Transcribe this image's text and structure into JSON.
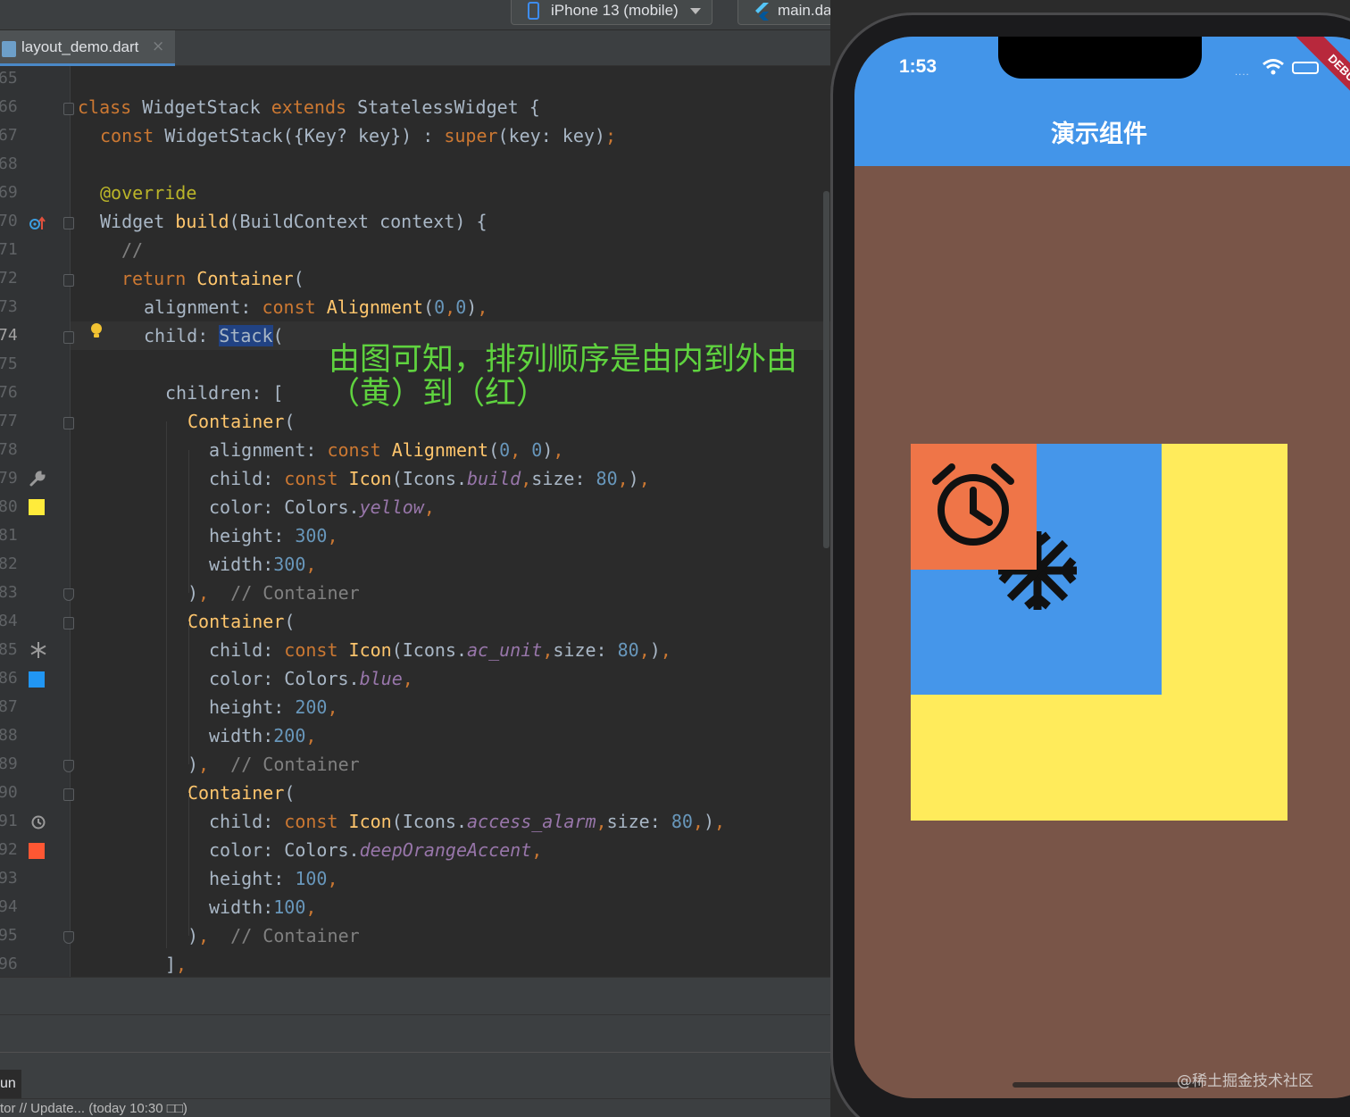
{
  "toolbar": {
    "device_selector": "iPhone 13 (mobile)",
    "config_selector": "main.dart"
  },
  "tab": {
    "filename": "layout_demo.dart",
    "close_glyph": "×"
  },
  "editor": {
    "lines": [
      {
        "n": "65"
      },
      {
        "n": "66"
      },
      {
        "n": "67"
      },
      {
        "n": "68"
      },
      {
        "n": "69"
      },
      {
        "n": "70"
      },
      {
        "n": "71"
      },
      {
        "n": "72"
      },
      {
        "n": "73"
      },
      {
        "n": "74"
      },
      {
        "n": "75"
      },
      {
        "n": "76"
      },
      {
        "n": "77"
      },
      {
        "n": "78"
      },
      {
        "n": "79"
      },
      {
        "n": "80"
      },
      {
        "n": "81"
      },
      {
        "n": "82"
      },
      {
        "n": "83"
      },
      {
        "n": "84"
      },
      {
        "n": "85"
      },
      {
        "n": "86"
      },
      {
        "n": "87"
      },
      {
        "n": "88"
      },
      {
        "n": "89"
      },
      {
        "n": "90"
      },
      {
        "n": "91"
      },
      {
        "n": "92"
      },
      {
        "n": "93"
      },
      {
        "n": "94"
      },
      {
        "n": "95"
      },
      {
        "n": "96"
      }
    ],
    "code": {
      "l66": [
        [
          "kw",
          "class "
        ],
        [
          "pl",
          "WidgetStack "
        ],
        [
          "kw",
          "extends "
        ],
        [
          "pl",
          "StatelessWidget {"
        ]
      ],
      "l67": [
        [
          "kw",
          "const "
        ],
        [
          "pl",
          "WidgetStack({Key? key}) : "
        ],
        [
          "kw",
          "super"
        ],
        [
          "pl",
          "(key: key)"
        ],
        [
          "kw",
          ";"
        ]
      ],
      "l69": [
        [
          "an",
          "@override"
        ]
      ],
      "l70": [
        [
          "pl",
          "Widget "
        ],
        [
          "fn",
          "build"
        ],
        [
          "pl",
          "(BuildContext context) {"
        ]
      ],
      "l71": [
        [
          "cm",
          "//"
        ]
      ],
      "l72": [
        [
          "kw",
          "return "
        ],
        [
          "fn",
          "Container"
        ],
        [
          "pl",
          "("
        ]
      ],
      "l73": [
        [
          "pl",
          "alignment: "
        ],
        [
          "kw",
          "const "
        ],
        [
          "fn",
          "Alignment"
        ],
        [
          "pl",
          "("
        ],
        [
          "nm",
          "0"
        ],
        [
          "kw",
          ","
        ],
        [
          "nm",
          "0"
        ],
        [
          "pl",
          ")"
        ],
        [
          "kw",
          ","
        ]
      ],
      "l74": [
        [
          "pl",
          "child: "
        ],
        [
          "hl",
          "Stack"
        ],
        [
          "pl",
          "("
        ]
      ],
      "l76": [
        [
          "pl",
          "children: ["
        ]
      ],
      "l77": [
        [
          "fn",
          "Container"
        ],
        [
          "pl",
          "("
        ]
      ],
      "l78": [
        [
          "pl",
          "alignment: "
        ],
        [
          "kw",
          "const "
        ],
        [
          "fn",
          "Alignment"
        ],
        [
          "pl",
          "("
        ],
        [
          "nm",
          "0"
        ],
        [
          "kw",
          ", "
        ],
        [
          "nm",
          "0"
        ],
        [
          "pl",
          ")"
        ],
        [
          "kw",
          ","
        ]
      ],
      "l79": [
        [
          "pl",
          "child: "
        ],
        [
          "kw",
          "const "
        ],
        [
          "fn",
          "Icon"
        ],
        [
          "pl",
          "(Icons."
        ],
        [
          "it",
          "build"
        ],
        [
          "kw",
          ","
        ],
        [
          "pl",
          "size: "
        ],
        [
          "nm",
          "80"
        ],
        [
          "kw",
          ","
        ],
        [
          "pl",
          ")"
        ],
        [
          "kw",
          ","
        ]
      ],
      "l80": [
        [
          "pl",
          "color: Colors."
        ],
        [
          "it",
          "yellow"
        ],
        [
          "kw",
          ","
        ]
      ],
      "l81": [
        [
          "pl",
          "height: "
        ],
        [
          "nm",
          "300"
        ],
        [
          "kw",
          ","
        ]
      ],
      "l82": [
        [
          "pl",
          "width:"
        ],
        [
          "nm",
          "300"
        ],
        [
          "kw",
          ","
        ]
      ],
      "l83": [
        [
          "pl",
          ")"
        ],
        [
          "kw",
          ","
        ],
        [
          "cm",
          "  // Container"
        ]
      ],
      "l84": [
        [
          "fn",
          "Container"
        ],
        [
          "pl",
          "("
        ]
      ],
      "l85": [
        [
          "pl",
          "child: "
        ],
        [
          "kw",
          "const "
        ],
        [
          "fn",
          "Icon"
        ],
        [
          "pl",
          "(Icons."
        ],
        [
          "it",
          "ac_unit"
        ],
        [
          "kw",
          ","
        ],
        [
          "pl",
          "size: "
        ],
        [
          "nm",
          "80"
        ],
        [
          "kw",
          ","
        ],
        [
          "pl",
          ")"
        ],
        [
          "kw",
          ","
        ]
      ],
      "l86": [
        [
          "pl",
          "color: Colors."
        ],
        [
          "it",
          "blue"
        ],
        [
          "kw",
          ","
        ]
      ],
      "l87": [
        [
          "pl",
          "height: "
        ],
        [
          "nm",
          "200"
        ],
        [
          "kw",
          ","
        ]
      ],
      "l88": [
        [
          "pl",
          "width:"
        ],
        [
          "nm",
          "200"
        ],
        [
          "kw",
          ","
        ]
      ],
      "l89": [
        [
          "pl",
          ")"
        ],
        [
          "kw",
          ","
        ],
        [
          "cm",
          "  // Container"
        ]
      ],
      "l90": [
        [
          "fn",
          "Container"
        ],
        [
          "pl",
          "("
        ]
      ],
      "l91": [
        [
          "pl",
          "child: "
        ],
        [
          "kw",
          "const "
        ],
        [
          "fn",
          "Icon"
        ],
        [
          "pl",
          "(Icons."
        ],
        [
          "it",
          "access_alarm"
        ],
        [
          "kw",
          ","
        ],
        [
          "pl",
          "size: "
        ],
        [
          "nm",
          "80"
        ],
        [
          "kw",
          ","
        ],
        [
          "pl",
          ")"
        ],
        [
          "kw",
          ","
        ]
      ],
      "l92": [
        [
          "pl",
          "color: Colors."
        ],
        [
          "it",
          "deepOrangeAccent"
        ],
        [
          "kw",
          ","
        ]
      ],
      "l93": [
        [
          "pl",
          "height: "
        ],
        [
          "nm",
          "100"
        ],
        [
          "kw",
          ","
        ]
      ],
      "l94": [
        [
          "pl",
          "width:"
        ],
        [
          "nm",
          "100"
        ],
        [
          "kw",
          ","
        ]
      ],
      "l95": [
        [
          "pl",
          ")"
        ],
        [
          "kw",
          ","
        ],
        [
          "cm",
          "  // Container"
        ]
      ],
      "l96": [
        [
          "pl",
          "]"
        ],
        [
          "kw",
          ","
        ]
      ]
    },
    "annotation": "由图可知，排列顺序是由内到外由（黄）到（红）"
  },
  "panels": {
    "run_tab": "un",
    "status": "tor // Update... (today 10:30 □□)"
  },
  "simulator": {
    "time": "1:53",
    "app_title": "演示组件",
    "debug_banner": "DEBUG",
    "colors": {
      "appbar": "#4395e9",
      "background": "#795548",
      "yellow": "#ffeb5b",
      "blue": "#4596ea",
      "orange": "#ef7548"
    }
  },
  "watermark": "@稀土掘金技术社区"
}
